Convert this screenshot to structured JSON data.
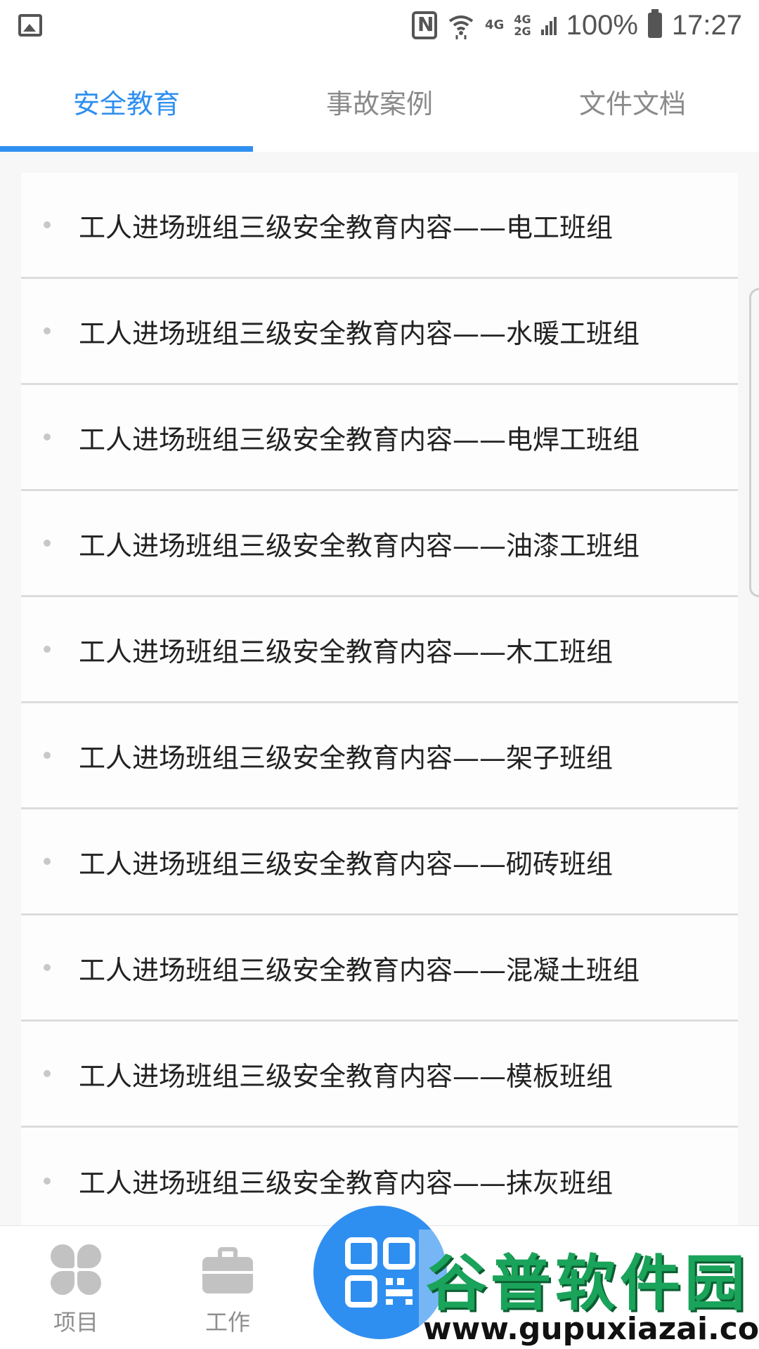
{
  "status_bar": {
    "network_top": "4G",
    "network_stack_top": "4G",
    "network_stack_bottom": "2G",
    "battery": "100%",
    "time": "17:27",
    "icons": [
      "gallery-icon",
      "nfc-icon",
      "wifi-icon",
      "signal-icon",
      "battery-icon"
    ]
  },
  "tabs": [
    {
      "label": "安全教育",
      "active": true
    },
    {
      "label": "事故案例",
      "active": false
    },
    {
      "label": "文件文档",
      "active": false
    }
  ],
  "list": {
    "items": [
      "工人进场班组三级安全教育内容——电工班组",
      "工人进场班组三级安全教育内容——水暖工班组",
      "工人进场班组三级安全教育内容——电焊工班组",
      "工人进场班组三级安全教育内容——油漆工班组",
      "工人进场班组三级安全教育内容——木工班组",
      "工人进场班组三级安全教育内容——架子班组",
      "工人进场班组三级安全教育内容——砌砖班组",
      "工人进场班组三级安全教育内容——混凝土班组",
      "工人进场班组三级安全教育内容——模板班组",
      "工人进场班组三级安全教育内容——抹灰班组"
    ]
  },
  "bottom_nav": {
    "items": [
      {
        "label": "项目",
        "icon": "clover-icon"
      },
      {
        "label": "工作",
        "icon": "briefcase-icon"
      }
    ],
    "center_icon": "qr-scan-icon"
  },
  "watermark": {
    "title": "谷普软件园",
    "url": "www.gupuxiazai.com"
  },
  "colors": {
    "accent": "#2f8ff0",
    "tab_inactive": "#8a8a8a",
    "watermark_green": "#1aa35a"
  }
}
